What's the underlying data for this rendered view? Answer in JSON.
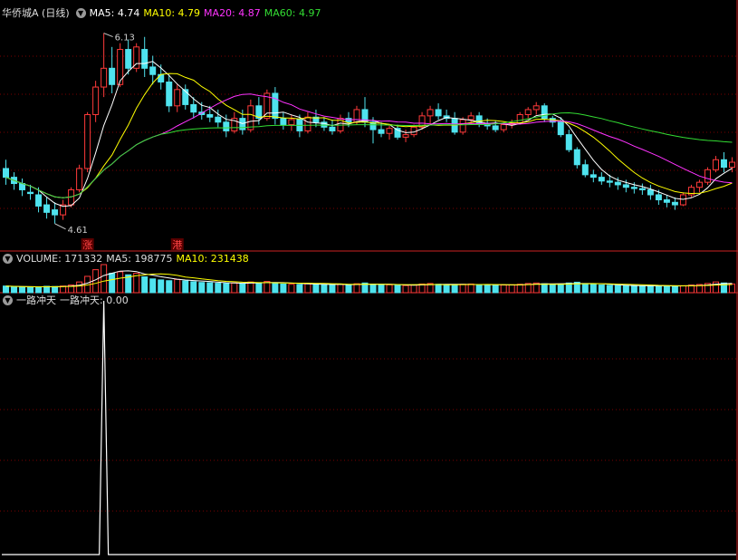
{
  "colors": {
    "up": "#ff3a3a",
    "down": "#4fe3ee",
    "ma5": "#ffffff",
    "ma10": "#ffff00",
    "ma20": "#ff33ff",
    "ma60": "#33dd33",
    "grid": "#7a0000",
    "divider": "#cc2222",
    "signal": "#ffffff"
  },
  "price_panel": {
    "title": "华侨城A (日线)",
    "ma5_label": "MA5: 4.74",
    "ma10_label": "MA10: 4.79",
    "ma20_label": "MA20: 4.87",
    "ma60_label": "MA60: 4.97",
    "high_label": "6.13",
    "low_label": "4.61",
    "marker1": "涨",
    "marker2": "港"
  },
  "volume_panel": {
    "volume_label": "VOLUME: 171332",
    "ma5_label": "MA5: 198775",
    "ma10_label": "MA10: 231438"
  },
  "indicator_panel": {
    "title": "一路冲天",
    "value_label": "一路冲天: 0.00"
  },
  "chart_data": [
    {
      "type": "candlestick",
      "title": "华侨城A (日线)",
      "ylim": [
        4.5,
        6.25
      ],
      "annotations": {
        "high": 6.13,
        "low": 4.61
      },
      "ohlc": [
        [
          5.05,
          5.12,
          4.92,
          4.98
        ],
        [
          4.98,
          5.02,
          4.88,
          4.93
        ],
        [
          4.93,
          4.97,
          4.83,
          4.88
        ],
        [
          4.86,
          4.92,
          4.8,
          4.85
        ],
        [
          4.84,
          4.9,
          4.7,
          4.75
        ],
        [
          4.76,
          4.82,
          4.65,
          4.7
        ],
        [
          4.72,
          4.78,
          4.61,
          4.68
        ],
        [
          4.68,
          4.8,
          4.64,
          4.76
        ],
        [
          4.76,
          4.9,
          4.74,
          4.88
        ],
        [
          4.88,
          5.08,
          4.86,
          5.05
        ],
        [
          5.05,
          5.5,
          5.02,
          5.48
        ],
        [
          5.48,
          5.75,
          5.42,
          5.7
        ],
        [
          5.7,
          6.13,
          5.62,
          5.85
        ],
        [
          5.85,
          6.02,
          5.65,
          5.72
        ],
        [
          5.72,
          6.05,
          5.7,
          6.0
        ],
        [
          6.0,
          6.08,
          5.8,
          5.85
        ],
        [
          5.85,
          6.05,
          5.82,
          6.02
        ],
        [
          6.0,
          6.1,
          5.78,
          5.85
        ],
        [
          5.86,
          5.95,
          5.72,
          5.8
        ],
        [
          5.8,
          5.88,
          5.68,
          5.74
        ],
        [
          5.74,
          5.8,
          5.5,
          5.55
        ],
        [
          5.55,
          5.72,
          5.5,
          5.68
        ],
        [
          5.68,
          5.72,
          5.52,
          5.56
        ],
        [
          5.56,
          5.62,
          5.45,
          5.5
        ],
        [
          5.5,
          5.58,
          5.44,
          5.48
        ],
        [
          5.48,
          5.55,
          5.42,
          5.46
        ],
        [
          5.46,
          5.52,
          5.38,
          5.42
        ],
        [
          5.42,
          5.48,
          5.3,
          5.35
        ],
        [
          5.35,
          5.5,
          5.33,
          5.45
        ],
        [
          5.45,
          5.52,
          5.32,
          5.36
        ],
        [
          5.36,
          5.6,
          5.34,
          5.55
        ],
        [
          5.55,
          5.62,
          5.4,
          5.45
        ],
        [
          5.45,
          5.68,
          5.43,
          5.65
        ],
        [
          5.65,
          5.7,
          5.4,
          5.45
        ],
        [
          5.45,
          5.5,
          5.36,
          5.4
        ],
        [
          5.4,
          5.48,
          5.35,
          5.44
        ],
        [
          5.44,
          5.48,
          5.3,
          5.35
        ],
        [
          5.35,
          5.5,
          5.33,
          5.46
        ],
        [
          5.46,
          5.52,
          5.38,
          5.42
        ],
        [
          5.42,
          5.46,
          5.35,
          5.38
        ],
        [
          5.38,
          5.44,
          5.32,
          5.35
        ],
        [
          5.35,
          5.48,
          5.33,
          5.45
        ],
        [
          5.45,
          5.5,
          5.38,
          5.42
        ],
        [
          5.42,
          5.55,
          5.4,
          5.52
        ],
        [
          5.52,
          5.62,
          5.38,
          5.42
        ],
        [
          5.42,
          5.46,
          5.25,
          5.36
        ],
        [
          5.36,
          5.42,
          5.3,
          5.33
        ],
        [
          5.33,
          5.4,
          5.28,
          5.37
        ],
        [
          5.37,
          5.4,
          5.28,
          5.3
        ],
        [
          5.3,
          5.36,
          5.26,
          5.32
        ],
        [
          5.32,
          5.4,
          5.3,
          5.38
        ],
        [
          5.38,
          5.5,
          5.36,
          5.47
        ],
        [
          5.47,
          5.55,
          5.4,
          5.52
        ],
        [
          5.52,
          5.57,
          5.44,
          5.47
        ],
        [
          5.47,
          5.52,
          5.42,
          5.45
        ],
        [
          5.45,
          5.5,
          5.32,
          5.34
        ],
        [
          5.34,
          5.46,
          5.32,
          5.44
        ],
        [
          5.44,
          5.5,
          5.4,
          5.47
        ],
        [
          5.47,
          5.5,
          5.38,
          5.41
        ],
        [
          5.41,
          5.45,
          5.36,
          5.39
        ],
        [
          5.39,
          5.43,
          5.34,
          5.36
        ],
        [
          5.36,
          5.42,
          5.34,
          5.4
        ],
        [
          5.4,
          5.44,
          5.37,
          5.41
        ],
        [
          5.41,
          5.5,
          5.4,
          5.48
        ],
        [
          5.48,
          5.54,
          5.45,
          5.52
        ],
        [
          5.52,
          5.58,
          5.48,
          5.55
        ],
        [
          5.55,
          5.57,
          5.42,
          5.45
        ],
        [
          5.45,
          5.47,
          5.38,
          5.42
        ],
        [
          5.42,
          5.46,
          5.3,
          5.32
        ],
        [
          5.32,
          5.36,
          5.18,
          5.2
        ],
        [
          5.2,
          5.22,
          5.05,
          5.08
        ],
        [
          5.08,
          5.12,
          4.98,
          5.0
        ],
        [
          5.0,
          5.04,
          4.94,
          4.98
        ],
        [
          4.98,
          5.02,
          4.92,
          4.95
        ],
        [
          4.95,
          5.0,
          4.9,
          4.94
        ],
        [
          4.94,
          4.98,
          4.88,
          4.92
        ],
        [
          4.92,
          4.96,
          4.86,
          4.9
        ],
        [
          4.9,
          4.94,
          4.85,
          4.89
        ],
        [
          4.89,
          4.93,
          4.84,
          4.88
        ],
        [
          4.88,
          4.92,
          4.8,
          4.84
        ],
        [
          4.84,
          4.88,
          4.76,
          4.8
        ],
        [
          4.8,
          4.84,
          4.74,
          4.78
        ],
        [
          4.78,
          4.82,
          4.72,
          4.76
        ],
        [
          4.76,
          4.86,
          4.75,
          4.84
        ],
        [
          4.84,
          4.92,
          4.82,
          4.9
        ],
        [
          4.9,
          4.96,
          4.86,
          4.94
        ],
        [
          4.94,
          5.06,
          4.92,
          5.04
        ],
        [
          5.04,
          5.15,
          5.02,
          5.12
        ],
        [
          5.12,
          5.18,
          5.02,
          5.06
        ],
        [
          5.06,
          5.14,
          5.02,
          5.1
        ]
      ],
      "series": [
        {
          "name": "MA5",
          "period": 5
        },
        {
          "name": "MA10",
          "period": 10
        },
        {
          "name": "MA20",
          "period": 20
        },
        {
          "name": "MA60",
          "period": 60
        }
      ]
    },
    {
      "type": "bar",
      "title": "VOLUME",
      "values": [
        260,
        240,
        220,
        210,
        230,
        250,
        240,
        260,
        300,
        420,
        640,
        900,
        1100,
        760,
        820,
        700,
        760,
        620,
        540,
        500,
        470,
        520,
        460,
        430,
        400,
        390,
        370,
        360,
        380,
        350,
        420,
        390,
        440,
        380,
        340,
        330,
        320,
        360,
        330,
        310,
        300,
        330,
        310,
        350,
        380,
        320,
        300,
        310,
        290,
        280,
        300,
        340,
        360,
        330,
        310,
        300,
        330,
        340,
        310,
        300,
        290,
        300,
        310,
        330,
        360,
        380,
        350,
        320,
        340,
        380,
        410,
        350,
        320,
        300,
        290,
        280,
        270,
        270,
        260,
        270,
        280,
        260,
        250,
        270,
        300,
        320,
        360,
        420,
        380,
        340
      ]
    },
    {
      "type": "line",
      "title": "一路冲天",
      "signal_index": 12,
      "values_note_free": true,
      "baseline": 0,
      "peak": 1
    }
  ]
}
